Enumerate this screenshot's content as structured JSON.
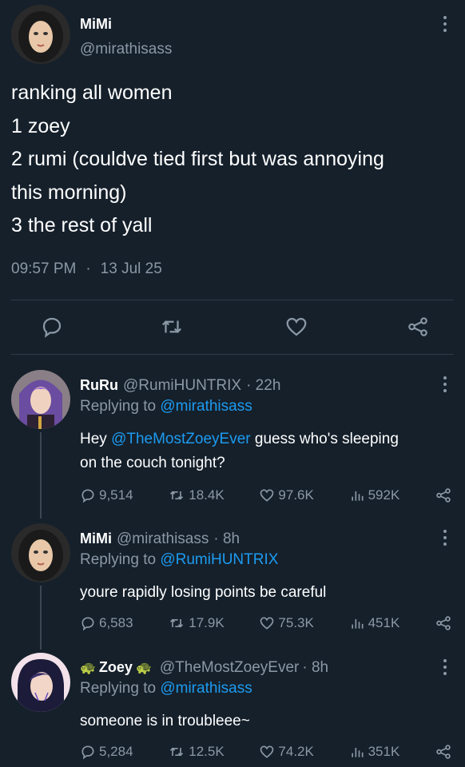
{
  "main_tweet": {
    "name": "MiMi",
    "handle": "@mirathisass",
    "lines": [
      "ranking all women",
      "1 zoey",
      "2 rumi (couldve tied first but was annoying",
      "this morning)",
      "3 the rest of yall"
    ],
    "time": "09:57 PM",
    "dot": "·",
    "date": "13 Jul 25"
  },
  "replies": [
    {
      "name": "RuRu",
      "handle": "@RumiHUNTRIX",
      "age": "· 22h",
      "replying_prefix": "Replying to",
      "replying_to": "@mirathisass",
      "text_before": "Hey ",
      "mention": "@TheMostZoeyEver",
      "text_after": " guess who's sleeping",
      "text_line2": "on the couch tonight?",
      "replies": "9,514",
      "retweets": "18.4K",
      "likes": "97.6K",
      "views": "592K"
    },
    {
      "name": "MiMi",
      "handle": "@mirathisass",
      "age": "· 8h",
      "replying_prefix": "Replying to",
      "replying_to": "@RumiHUNTRIX",
      "text": "youre rapidly losing points be careful",
      "replies": "6,583",
      "retweets": "17.9K",
      "likes": "75.3K",
      "views": "451K"
    },
    {
      "name": "Zoey",
      "name_emoji": "🐢",
      "handle": "@TheMostZoeyEver",
      "age": "· 8h",
      "replying_prefix": "Replying to",
      "replying_to": "@mirathisass",
      "text": "someone is in troubleee~",
      "replies": "5,284",
      "retweets": "12.5K",
      "likes": "74.2K",
      "views": "351K"
    }
  ],
  "colors": {
    "background": "#15202b",
    "muted": "#8b98a5",
    "link": "#1d9bf0",
    "turtle": "#5cb85c"
  }
}
